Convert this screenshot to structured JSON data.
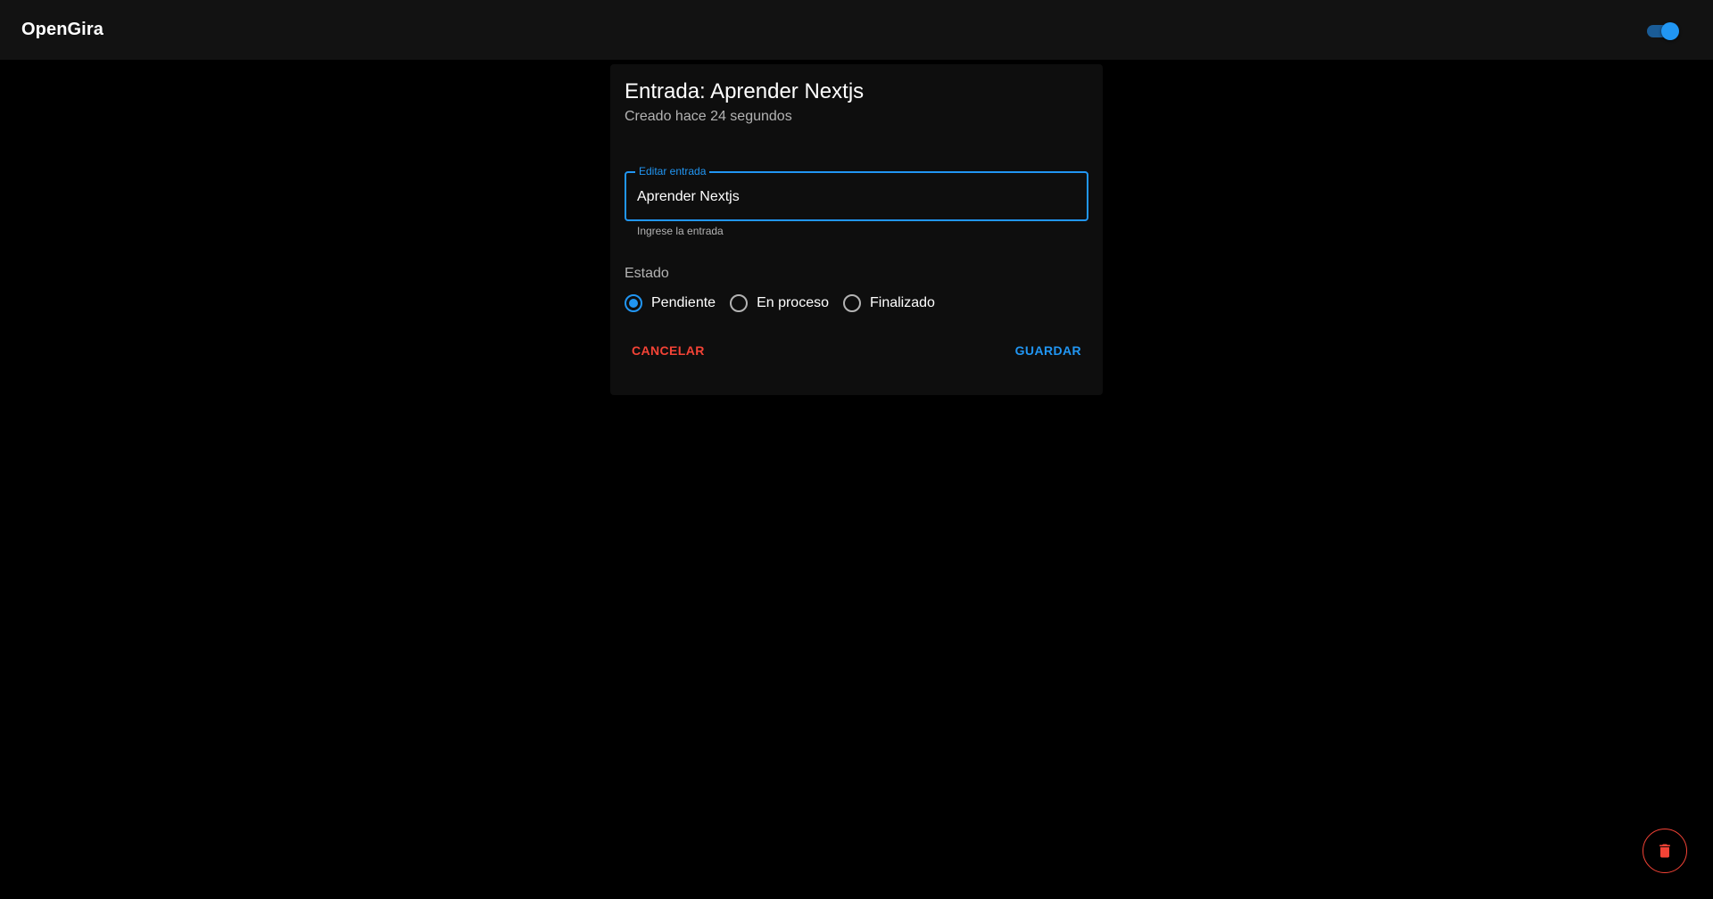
{
  "appbar": {
    "title": "OpenGira",
    "theme_toggle": {
      "checked": true,
      "accent": "#2196f3"
    }
  },
  "card": {
    "title": "Entrada: Aprender Nextjs",
    "subtitle": "Creado hace 24 segundos",
    "field": {
      "label": "Editar entrada",
      "value": "Aprender Nextjs",
      "helper": "Ingrese la entrada"
    },
    "estado": {
      "label": "Estado",
      "options": [
        {
          "label": "Pendiente",
          "checked": true
        },
        {
          "label": "En proceso",
          "checked": false
        },
        {
          "label": "Finalizado",
          "checked": false
        }
      ]
    },
    "actions": {
      "cancel_label": "CANCELAR",
      "save_label": "GUARDAR"
    }
  },
  "fab": {
    "icon": "trash-icon",
    "color": "#f44336"
  },
  "colors": {
    "primary": "#2196f3",
    "error": "#f44336",
    "background": "#000000",
    "surface": "#121212"
  }
}
